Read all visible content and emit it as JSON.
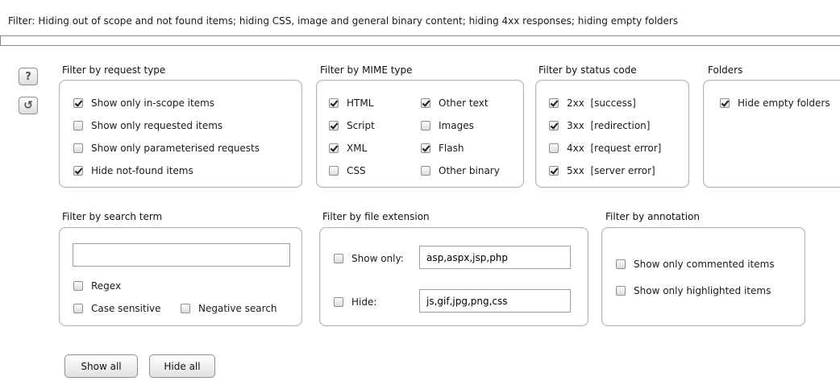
{
  "filter_bar": {
    "text": "Filter:  Hiding out of scope and not found items;  hiding CSS, image and general binary content;  hiding 4xx responses;  hiding empty folders"
  },
  "side_buttons": {
    "help_glyph": "?",
    "reset_glyph": "↺"
  },
  "request_type": {
    "title": "Filter by request type",
    "items": [
      {
        "label": "Show only in-scope items",
        "checked": true
      },
      {
        "label": "Show only requested items",
        "checked": false
      },
      {
        "label": "Show only parameterised requests",
        "checked": false
      },
      {
        "label": "Hide not-found items",
        "checked": true
      }
    ]
  },
  "mime_type": {
    "title": "Filter by MIME type",
    "items": [
      {
        "label": "HTML",
        "checked": true
      },
      {
        "label": "Script",
        "checked": true
      },
      {
        "label": "XML",
        "checked": true
      },
      {
        "label": "CSS",
        "checked": false
      },
      {
        "label": "Other text",
        "checked": true
      },
      {
        "label": "Images",
        "checked": false
      },
      {
        "label": "Flash",
        "checked": true
      },
      {
        "label": "Other binary",
        "checked": false
      }
    ]
  },
  "status_code": {
    "title": "Filter by status code",
    "items": [
      {
        "label": "2xx  [success]",
        "checked": true
      },
      {
        "label": "3xx  [redirection]",
        "checked": true
      },
      {
        "label": "4xx  [request error]",
        "checked": false
      },
      {
        "label": "5xx  [server error]",
        "checked": true
      }
    ]
  },
  "folders": {
    "title": "Folders",
    "items": [
      {
        "label": "Hide empty folders",
        "checked": true
      }
    ]
  },
  "search_term": {
    "title": "Filter by search term",
    "value": "",
    "items": [
      {
        "label": "Regex",
        "checked": false
      },
      {
        "label": "Case sensitive",
        "checked": false
      },
      {
        "label": "Negative search",
        "checked": false
      }
    ]
  },
  "file_extension": {
    "title": "Filter by file extension",
    "show_only": {
      "label": "Show only:",
      "checked": false,
      "value": "asp,aspx,jsp,php"
    },
    "hide": {
      "label": "Hide:",
      "checked": false,
      "value": "js,gif,jpg,png,css"
    }
  },
  "annotation": {
    "title": "Filter by annotation",
    "items": [
      {
        "label": "Show only commented items",
        "checked": false
      },
      {
        "label": "Show only highlighted items",
        "checked": false
      }
    ]
  },
  "actions": {
    "show_all": "Show all",
    "hide_all": "Hide all"
  }
}
